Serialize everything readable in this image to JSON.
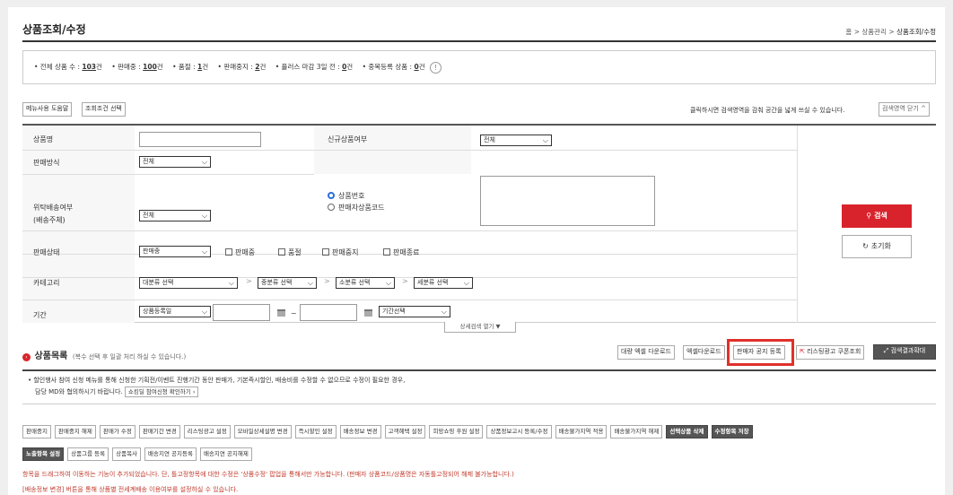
{
  "title": "상품조회/수정",
  "breadcrumb": {
    "home": "홈",
    "sep": ">",
    "section": "상품관리",
    "current": "상품조회/수정"
  },
  "summary": {
    "total_label": "• 전체 상품 수 : ",
    "total": "103",
    "total_unit": "건",
    "selling_label": "• 판매중 : ",
    "selling": "100",
    "selling_unit": "건",
    "soldout_label": "• 품절 : ",
    "soldout": "1",
    "soldout_unit": "건",
    "stopped_label": "• 판매중지 : ",
    "stopped": "2",
    "stopped_unit": "건",
    "plus_label": "• 플러스 마감 3일 전 : ",
    "plus": "0",
    "plus_unit": "건",
    "dup_label": "• 중복등록 상품 : ",
    "dup": "0",
    "dup_unit": "건",
    "info_icon": "!"
  },
  "toolbar": {
    "help": "메뉴사용 도움말",
    "select_cond": "조회조건 선택",
    "collapse_hint": "클릭하시면 검색영역을 감춰 공간을 넓게 쓰실 수 있습니다.",
    "collapse_btn": "검색영역 닫기 ^"
  },
  "form": {
    "name_label": "상품명",
    "new_label": "신규상품여부",
    "new_value": "전체",
    "method_label": "판매방식",
    "method_value": "전체",
    "radio_product_no": "상품번호",
    "radio_seller_code": "판매자상품코드",
    "consign_label1": "위탁배송여부",
    "consign_label2": "(배송주체)",
    "consign_value": "전체",
    "status_label": "판매상태",
    "status_value": "판매중",
    "status_cb": [
      "판매중",
      "품절",
      "판매중지",
      "판매종료"
    ],
    "category_label": "카테고리",
    "cat1": "대분류 선택",
    "cat2": "중분류 선택",
    "cat3": "소분류 선택",
    "cat4": "세분류 선택",
    "period_label": "기간",
    "period_type": "상품등록일",
    "period_sep": "~",
    "period_select": "기간선택",
    "search_btn": "검색",
    "reset_btn": "초기화",
    "detail_toggle": "상세검색 열기 ▼"
  },
  "list": {
    "title": "상품목록",
    "subtitle": "(복수 선택 후 일괄 처리 하실 수 있습니다.)",
    "btn_bulk_excel": "대량 엑셀 다운로드",
    "btn_excel": "엑셀다운로드",
    "btn_notice": "판매자 공지 등록",
    "btn_coupon": "리스팅광고 쿠폰조회",
    "btn_expand": "검색결과확대"
  },
  "notice": {
    "line1": "• 할인행사 참여 신청 메뉴를 통해 신청한 기획전/이벤트 진행기간 동안 판매가, 기본즉시할인, 배송비를 수정할 수 없으므로 수정이 필요한 경우,",
    "line2": "담당 MD와 협의하시기 바랍니다.",
    "link": "쇼킹딜 참여신청 확인하기 ›"
  },
  "actions_row1": [
    "판매중지",
    "판매중지 해제",
    "판매가 수정",
    "판매기간 변경",
    "리스팅광고 설정",
    "모바일상세설명 변경",
    "즉시할인 설정",
    "배송정보 변경",
    "고객혜택 설정",
    "희망쇼핑 후원 설정",
    "상품정보고시 등록/수정",
    "배송불가지역 적용",
    "배송불가지역 해제",
    "선택상품 삭제",
    "수정항목 저장"
  ],
  "actions_row2": [
    "노출항목 설정",
    "상품그룹 등록",
    "상품복사",
    "배송지연 공지등록",
    "배송지연 공지해제"
  ],
  "footer": {
    "line1": "항목을 드래그하여 이동하는 기능이 추가되었습니다. 단, 틀고정항목에 대한 수정은 '상품수정' 팝업을 통해서만 가능합니다. (판매자 상품코드/상품명은 자동틀고정되어 해제 불가능합니다.)",
    "line2": "[배송정보 변경] 버튼을 통해 상품별 전세계배송 이용여부를 설정하실 수 있습니다."
  },
  "colors": {
    "accent": "#d9232c",
    "highlight": "#e0302a",
    "dark_btn": "#555555",
    "link": "#c0392b"
  }
}
